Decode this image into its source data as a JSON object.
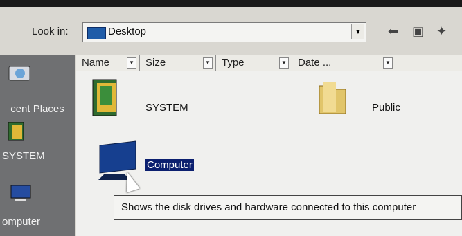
{
  "dialog": {
    "look_in_label": "Look in:",
    "look_in_value": "Desktop"
  },
  "toolbar": {
    "back_icon": "left-arrow-icon",
    "up_icon": "folder-up-icon",
    "new_folder_icon": "new-folder-icon"
  },
  "sidebar": {
    "items": [
      {
        "label": "cent Places",
        "icon": "recent-places-icon"
      },
      {
        "label": "SYSTEM",
        "icon": "system-folder-icon"
      },
      {
        "label": "omputer",
        "icon": "computer-icon"
      }
    ]
  },
  "columns": [
    {
      "label": "Name"
    },
    {
      "label": "Size"
    },
    {
      "label": "Type"
    },
    {
      "label": "Date ..."
    }
  ],
  "files": [
    {
      "name": "SYSTEM",
      "icon": "system-folder-icon"
    },
    {
      "name": "Public",
      "icon": "folder-icon"
    },
    {
      "name": "Computer",
      "icon": "computer-icon",
      "selected": true
    }
  ],
  "tooltip": {
    "text": "Shows the disk drives and hardware connected to this computer"
  }
}
